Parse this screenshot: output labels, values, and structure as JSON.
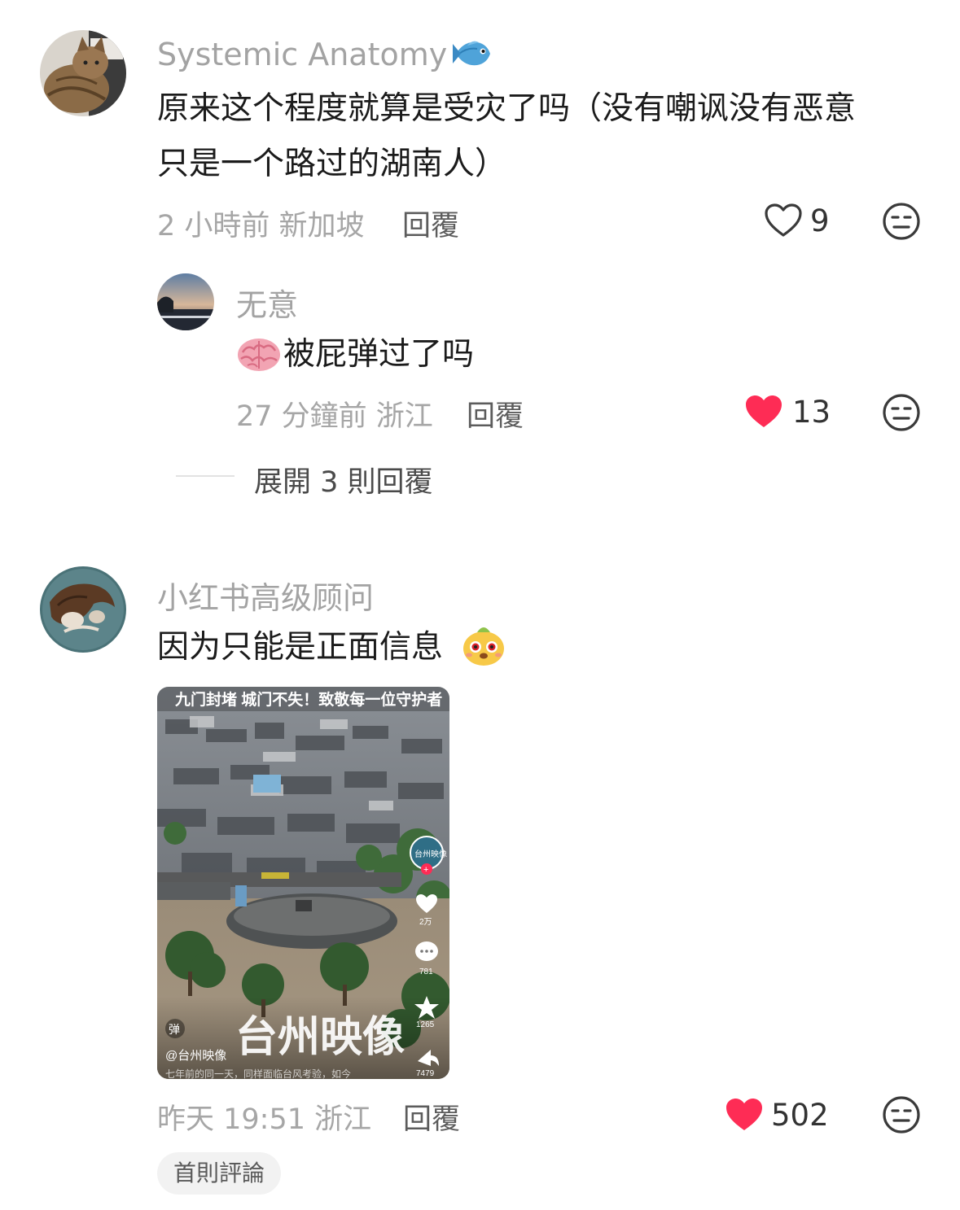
{
  "comments": [
    {
      "username": "Systemic Anatomy",
      "username_emoji_icon": "fish-icon",
      "text_line1": "原来这个程度就算是受灾了吗（没有嘲讽没有恶意",
      "text_line2": "只是一个路过的湖南人）",
      "meta": "2 小時前 新加坡",
      "reply_label": "回覆",
      "likes": "9",
      "liked": false
    },
    {
      "username": "无意",
      "emoji_icon": "brain-icon",
      "text": "被屁弹过了吗",
      "meta": "27 分鐘前 浙江",
      "reply_label": "回覆",
      "likes": "13",
      "liked": true
    },
    {
      "username": "小红书高级顾问",
      "text": "因为只能是正面信息",
      "emoji_icon": "dog-face-emoji-icon",
      "meta": "昨天 19:51 浙江",
      "reply_label": "回覆",
      "likes": "502",
      "liked": true,
      "media": {
        "caption_top": "九门封堵 城门不失！致敬每一位守护者",
        "watermark_title": "台州映像",
        "account_tag": "@台州映像",
        "danmaku_badge": "弹",
        "bottom_caption": "七年前的同一天，同样面临台风考验，如今",
        "side_avatar_label": "台州映像",
        "like_count": "2万",
        "comment_count": "781",
        "favorite_count": "1265",
        "share_count": "7479"
      }
    }
  ],
  "expand_replies_label": "展開 3 則回覆",
  "first_comment_chip": "首則評論",
  "colors": {
    "liked_heart": "#fe2c55",
    "muted_text": "#a6a6a6",
    "main_text": "#1b1b1b"
  }
}
